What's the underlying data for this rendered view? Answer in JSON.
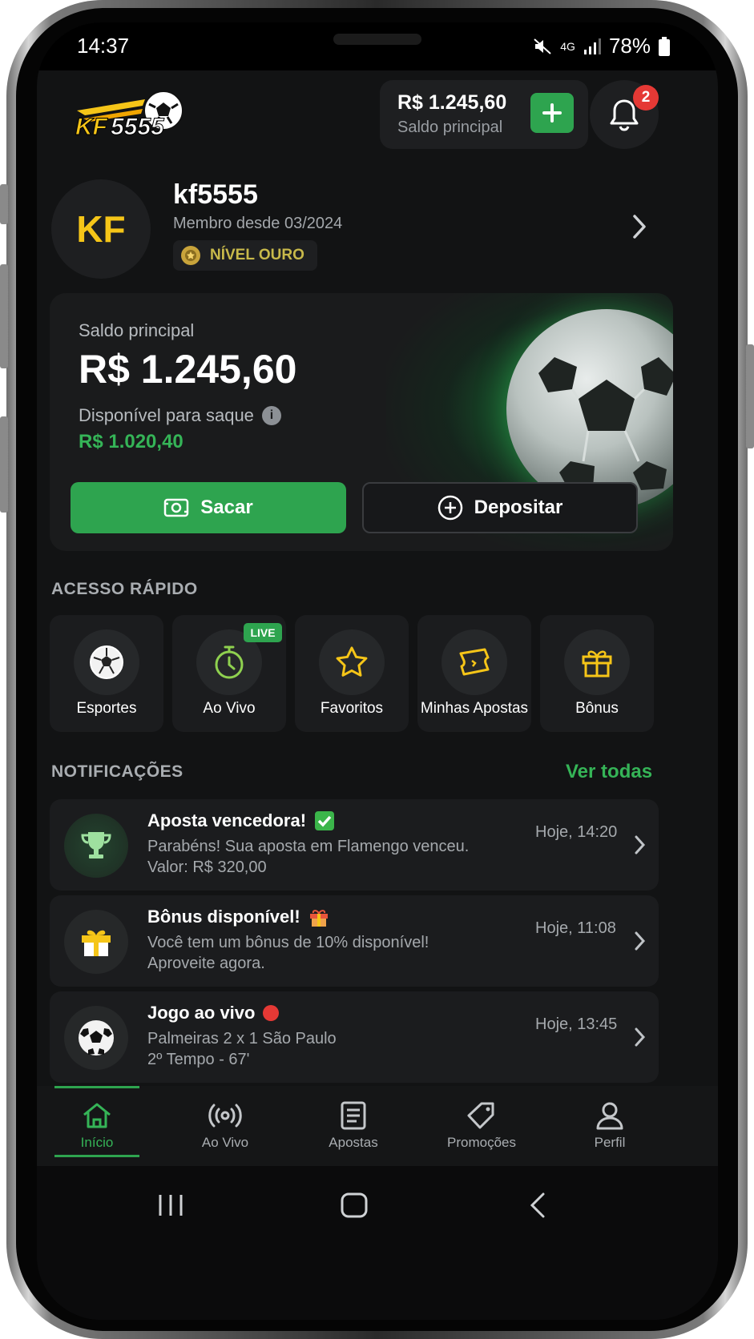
{
  "status_bar": {
    "time": "14:37",
    "network": "4G",
    "battery": "78%"
  },
  "header": {
    "logo_text": "KF5555",
    "balance_amount": "R$ 1.245,60",
    "balance_label": "Saldo principal",
    "notification_count": "2"
  },
  "profile": {
    "initials": "KF",
    "username": "kf5555",
    "member_since": "Membro desde 03/2024",
    "level": "NÍVEL OURO"
  },
  "wallet": {
    "label": "Saldo principal",
    "amount": "R$ 1.245,60",
    "available_label": "Disponível para saque",
    "available_amount": "R$ 1.020,40",
    "withdraw_label": "Sacar",
    "deposit_label": "Depositar"
  },
  "quick_access": {
    "title": "ACESSO RÁPIDO",
    "live_tag": "LIVE",
    "items": [
      {
        "label": "Esportes",
        "icon": "soccer-ball-icon"
      },
      {
        "label": "Ao Vivo",
        "icon": "stopwatch-icon"
      },
      {
        "label": "Favoritos",
        "icon": "star-icon"
      },
      {
        "label": "Minhas Apostas",
        "icon": "ticket-icon"
      },
      {
        "label": "Bônus",
        "icon": "gift-icon"
      }
    ]
  },
  "notifications": {
    "title": "NOTIFICAÇÕES",
    "see_all": "Ver todas",
    "items": [
      {
        "title": "Aposta vencedora!",
        "line1": "Parabéns! Sua aposta em Flamengo venceu.",
        "line2": "Valor: R$ 320,00",
        "time": "Hoje, 14:20",
        "icon": "trophy-icon"
      },
      {
        "title": "Bônus disponível!",
        "line1": "Você tem um bônus de 10% disponível!",
        "line2": "Aproveite agora.",
        "time": "Hoje, 11:08",
        "icon": "gift-icon"
      },
      {
        "title": "Jogo ao vivo",
        "line1": "Palmeiras 2 x 1 São Paulo",
        "line2": "2º Tempo - 67'",
        "time": "Hoje, 13:45",
        "icon": "soccer-ball-icon"
      }
    ]
  },
  "bottom_nav": {
    "items": [
      {
        "label": "Início",
        "icon": "home-icon",
        "active": true
      },
      {
        "label": "Ao Vivo",
        "icon": "broadcast-icon"
      },
      {
        "label": "Apostas",
        "icon": "document-icon"
      },
      {
        "label": "Promoções",
        "icon": "tag-icon"
      },
      {
        "label": "Perfil",
        "icon": "user-icon"
      }
    ]
  },
  "colors": {
    "accent": "#2ea44f",
    "background": "#121314",
    "gold": "#f5c518"
  }
}
